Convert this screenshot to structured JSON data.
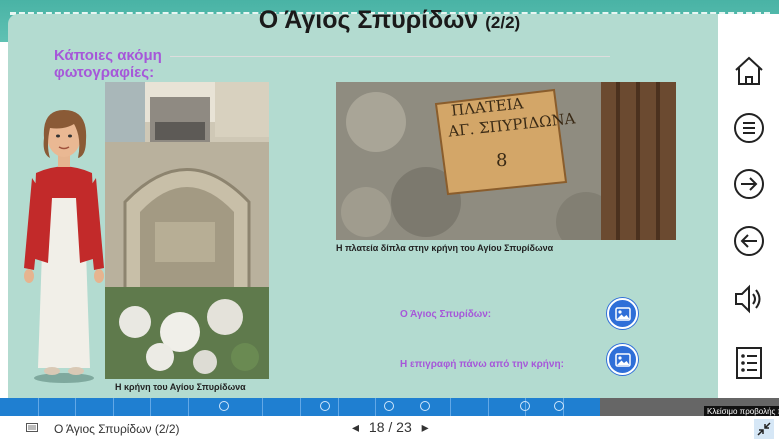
{
  "slide": {
    "title": "Ο Άγιος Σπυρίδων",
    "title_suffix": "(2/2)",
    "subtitle": "Κάποιες ακόμη φωτογραφίες:",
    "photo1_caption": "Η κρήνη του Αγίου Σπυρίδωνα",
    "photo2_caption": "Η πλατεία δίπλα στην κρήνη του Αγίου Σπυρίδωνα",
    "sign_line1": "ΠΛΑΤΕΙΑ",
    "sign_line2": "ΑΓ. ΣΠΥΡΙΔΩΝΑ",
    "sign_number": "8",
    "links": [
      {
        "label": "Ο Άγιος Σπυρίδων:"
      },
      {
        "label": "Η επιγραφή πάνω από την κρήνη:"
      }
    ]
  },
  "nav": {
    "icons": [
      "home-icon",
      "menu-icon",
      "next-icon",
      "previous-icon",
      "audio-icon",
      "index-icon"
    ]
  },
  "progress": {
    "current": 18,
    "total": 23
  },
  "status": {
    "slide_title": "Ο Άγιος Σπυρίδων (2/2)",
    "page_text": "18 / 23",
    "tooltip": "Κλείσιμο προβολής π"
  },
  "colors": {
    "slide_bg": "#b3dbd0",
    "accent_purple": "#a657d9",
    "button_blue": "#2f6fd8",
    "progress_blue": "#1f7fd1"
  }
}
